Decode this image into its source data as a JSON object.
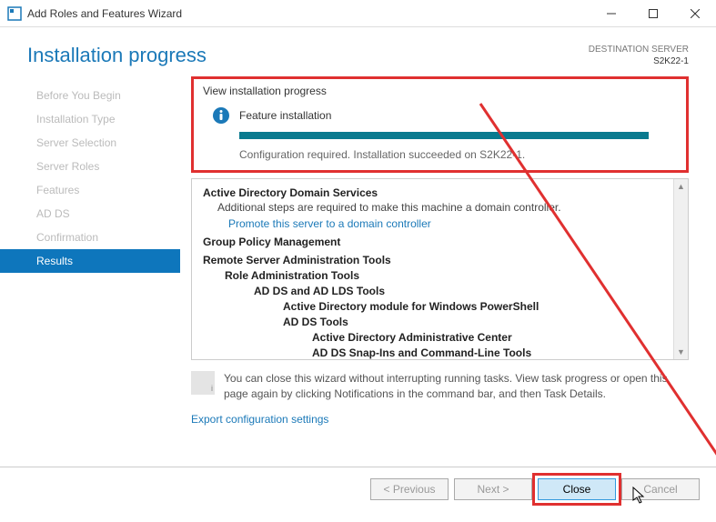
{
  "titlebar": {
    "title": "Add Roles and Features Wizard"
  },
  "header": {
    "heading": "Installation progress",
    "dest_label": "DESTINATION SERVER",
    "dest_name": "S2K22-1"
  },
  "sidebar": {
    "items": [
      {
        "label": "Before You Begin"
      },
      {
        "label": "Installation Type"
      },
      {
        "label": "Server Selection"
      },
      {
        "label": "Server Roles"
      },
      {
        "label": "Features"
      },
      {
        "label": "AD DS"
      },
      {
        "label": "Confirmation"
      },
      {
        "label": "Results"
      }
    ]
  },
  "main": {
    "section_label": "View installation progress",
    "status_text": "Feature installation",
    "config_msg": "Configuration required. Installation succeeded on S2K22-1.",
    "results": {
      "adds_title": "Active Directory Domain Services",
      "adds_sub": "Additional steps are required to make this machine a domain controller.",
      "adds_link": "Promote this server to a domain controller",
      "gpm": "Group Policy Management",
      "rsat": "Remote Server Administration Tools",
      "role_admin": "Role Administration Tools",
      "ad_lds": "AD DS and AD LDS Tools",
      "ad_ps": "Active Directory module for Windows PowerShell",
      "ad_tools": "AD DS Tools",
      "ad_center": "Active Directory Administrative Center",
      "ad_snap": "AD DS Snap-Ins and Command-Line Tools"
    },
    "note": "You can close this wizard without interrupting running tasks. View task progress or open this page again by clicking Notifications in the command bar, and then Task Details.",
    "export_link": "Export configuration settings"
  },
  "footer": {
    "previous": "< Previous",
    "next": "Next >",
    "close": "Close",
    "cancel": "Cancel"
  }
}
